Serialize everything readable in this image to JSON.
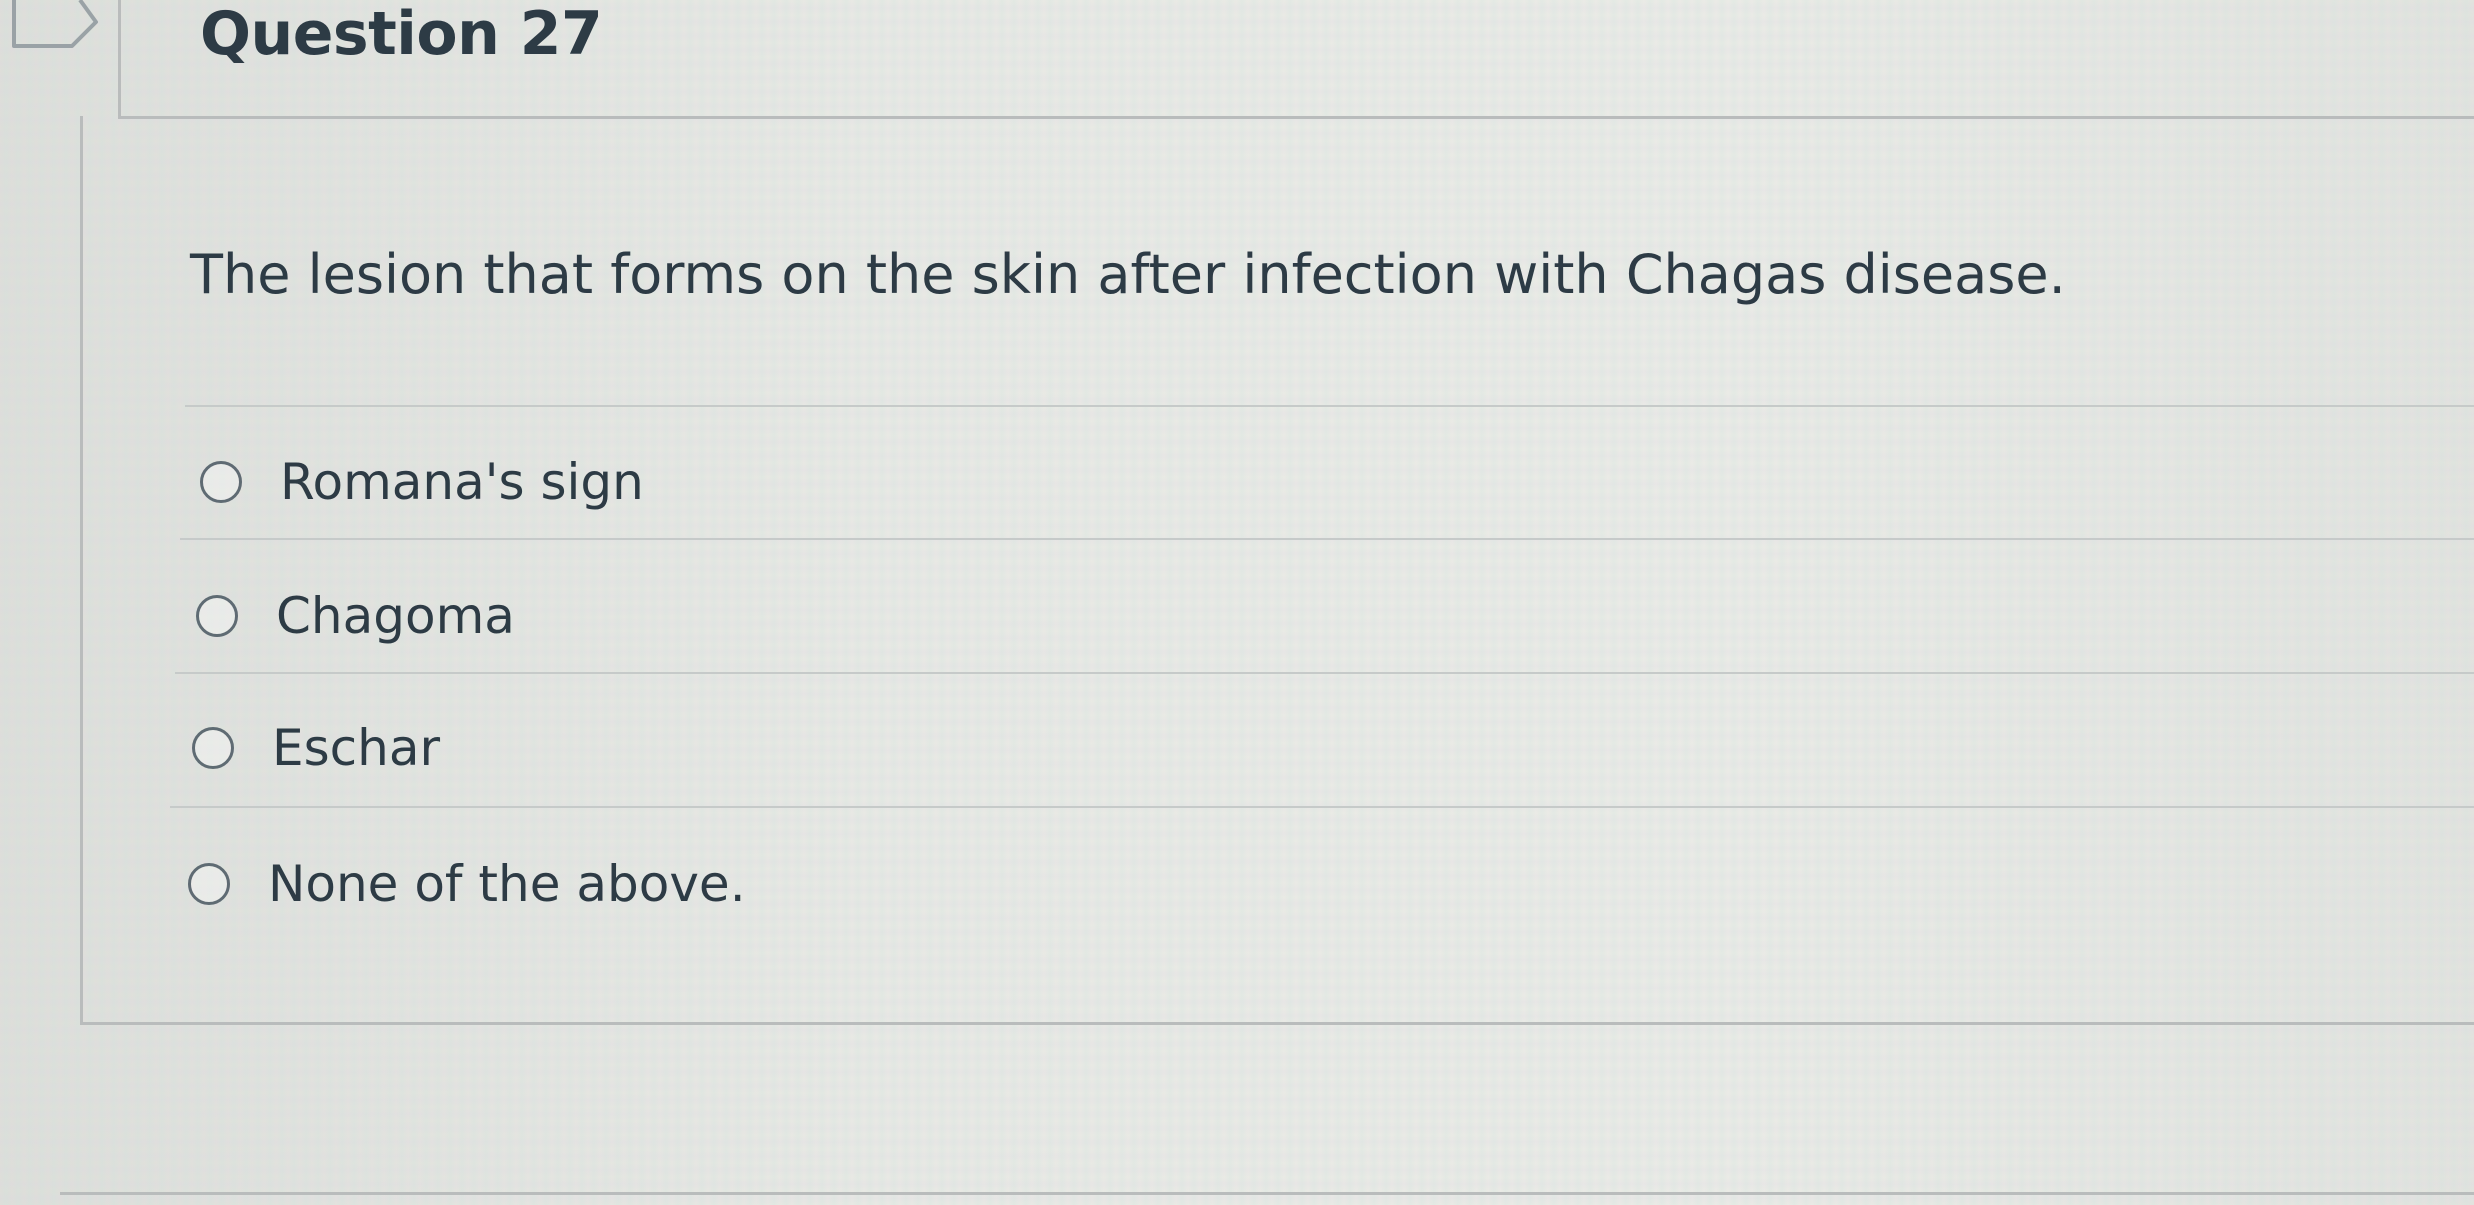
{
  "question": {
    "title": "Question 27",
    "text": "The lesion that forms on the skin after infection with Chagas disease.",
    "answers": [
      {
        "label": "Romana's sign",
        "selected": false
      },
      {
        "label": "Chagoma",
        "selected": false
      },
      {
        "label": "Eschar",
        "selected": false
      },
      {
        "label": "None of the above.",
        "selected": false
      }
    ]
  },
  "icons": {
    "flag": "flag-bookmark-icon",
    "radio": "radio-button-icon"
  },
  "colors": {
    "text": "#2d3b45",
    "border": "#b9bcbc",
    "radio": "#5f6b73"
  }
}
